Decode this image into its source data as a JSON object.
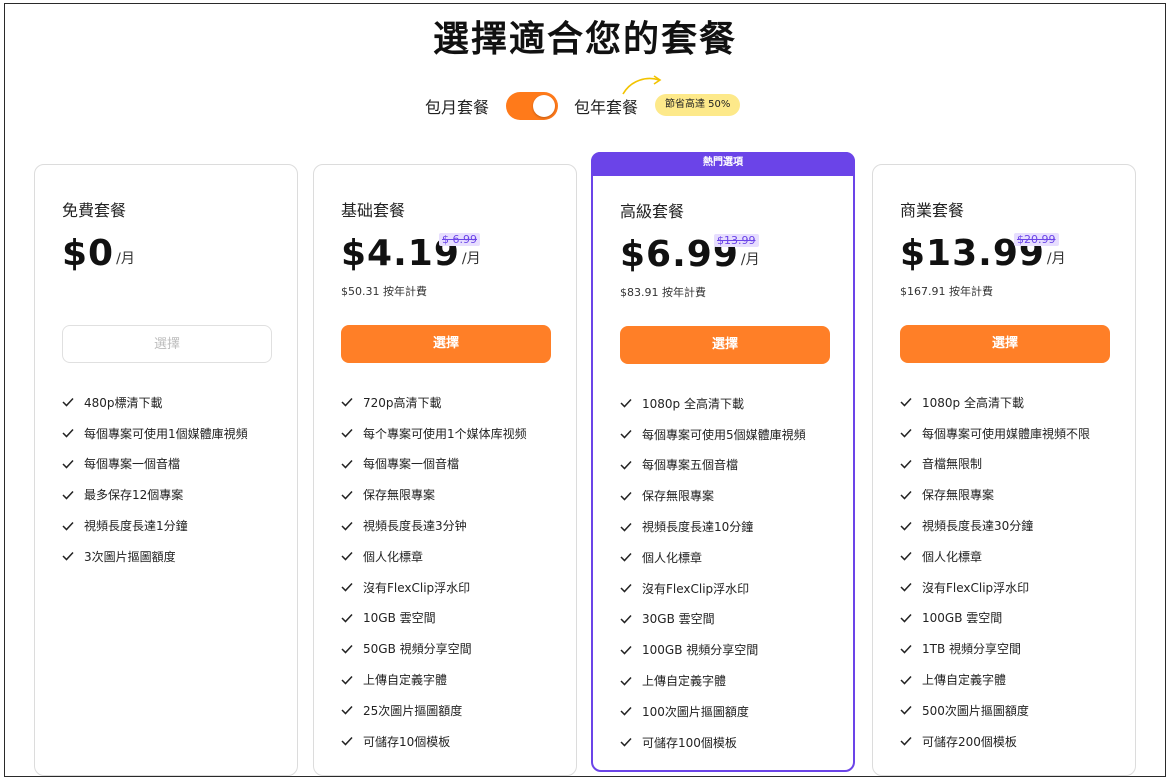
{
  "page": {
    "title": "選擇適合您的套餐"
  },
  "billing": {
    "monthly_label": "包月套餐",
    "yearly_label": "包年套餐",
    "toggle_state": "yearly",
    "save_badge": "節省高達 50%"
  },
  "colors": {
    "accent": "#ff7f27",
    "popular": "#6b44e8",
    "badge": "#fde98a"
  },
  "icons": {
    "feature": "check-icon",
    "toggle_hint": "curved-arrow-icon"
  },
  "plans": [
    {
      "name": "免費套餐",
      "price": "$0",
      "per": "/月",
      "old_price": "",
      "yearly_note": "",
      "button": "選擇",
      "button_state": "disabled",
      "features": [
        "480p標清下載",
        "每個專案可使用1個媒體庫視頻",
        "每個專案一個音檔",
        "最多保存12個專案",
        "視頻長度長達1分鐘",
        "3次圖片摳圖額度"
      ]
    },
    {
      "name": "基础套餐",
      "price": "$4.19",
      "per": "/月",
      "old_price": "$ 6.99",
      "yearly_note": "$50.31 按年計費",
      "button": "選擇",
      "button_state": "primary",
      "features": [
        "720p高清下載",
        "每个專案可使用1个媒体库视频",
        "每個專案一個音檔",
        "保存無限專案",
        "視頻長度長達3分钟",
        "個人化標章",
        "沒有FlexClip浮水印",
        "10GB 雲空間",
        "50GB 視頻分享空間",
        "上傳自定義字體",
        "25次圖片摳圖額度",
        "可儲存10個模板"
      ]
    },
    {
      "name": "高級套餐",
      "price": "$6.99",
      "per": "/月",
      "old_price": "$13.99",
      "yearly_note": "$83.91 按年計費",
      "button": "選擇",
      "button_state": "primary",
      "tag": "熱門選項",
      "features": [
        "1080p 全高清下載",
        "每個專案可使用5個媒體庫視頻",
        "每個專案五個音檔",
        "保存無限專案",
        "視頻長度長達10分鐘",
        "個人化標章",
        "沒有FlexClip浮水印",
        "30GB 雲空間",
        "100GB 視頻分享空間",
        "上傳自定義字體",
        "100次圖片摳圖額度",
        "可儲存100個模板"
      ]
    },
    {
      "name": "商業套餐",
      "price": "$13.99",
      "per": "/月",
      "old_price": "$20.99",
      "yearly_note": "$167.91 按年計費",
      "button": "選擇",
      "button_state": "primary",
      "features": [
        "1080p 全高清下載",
        "每個專案可使用媒體庫視頻不限",
        "音檔無限制",
        "保存無限專案",
        "視頻長度長達30分鐘",
        "個人化標章",
        "沒有FlexClip浮水印",
        "100GB 雲空間",
        "1TB 視頻分享空間",
        "上傳自定義字體",
        "500次圖片摳圖額度",
        "可儲存200個模板"
      ]
    }
  ]
}
